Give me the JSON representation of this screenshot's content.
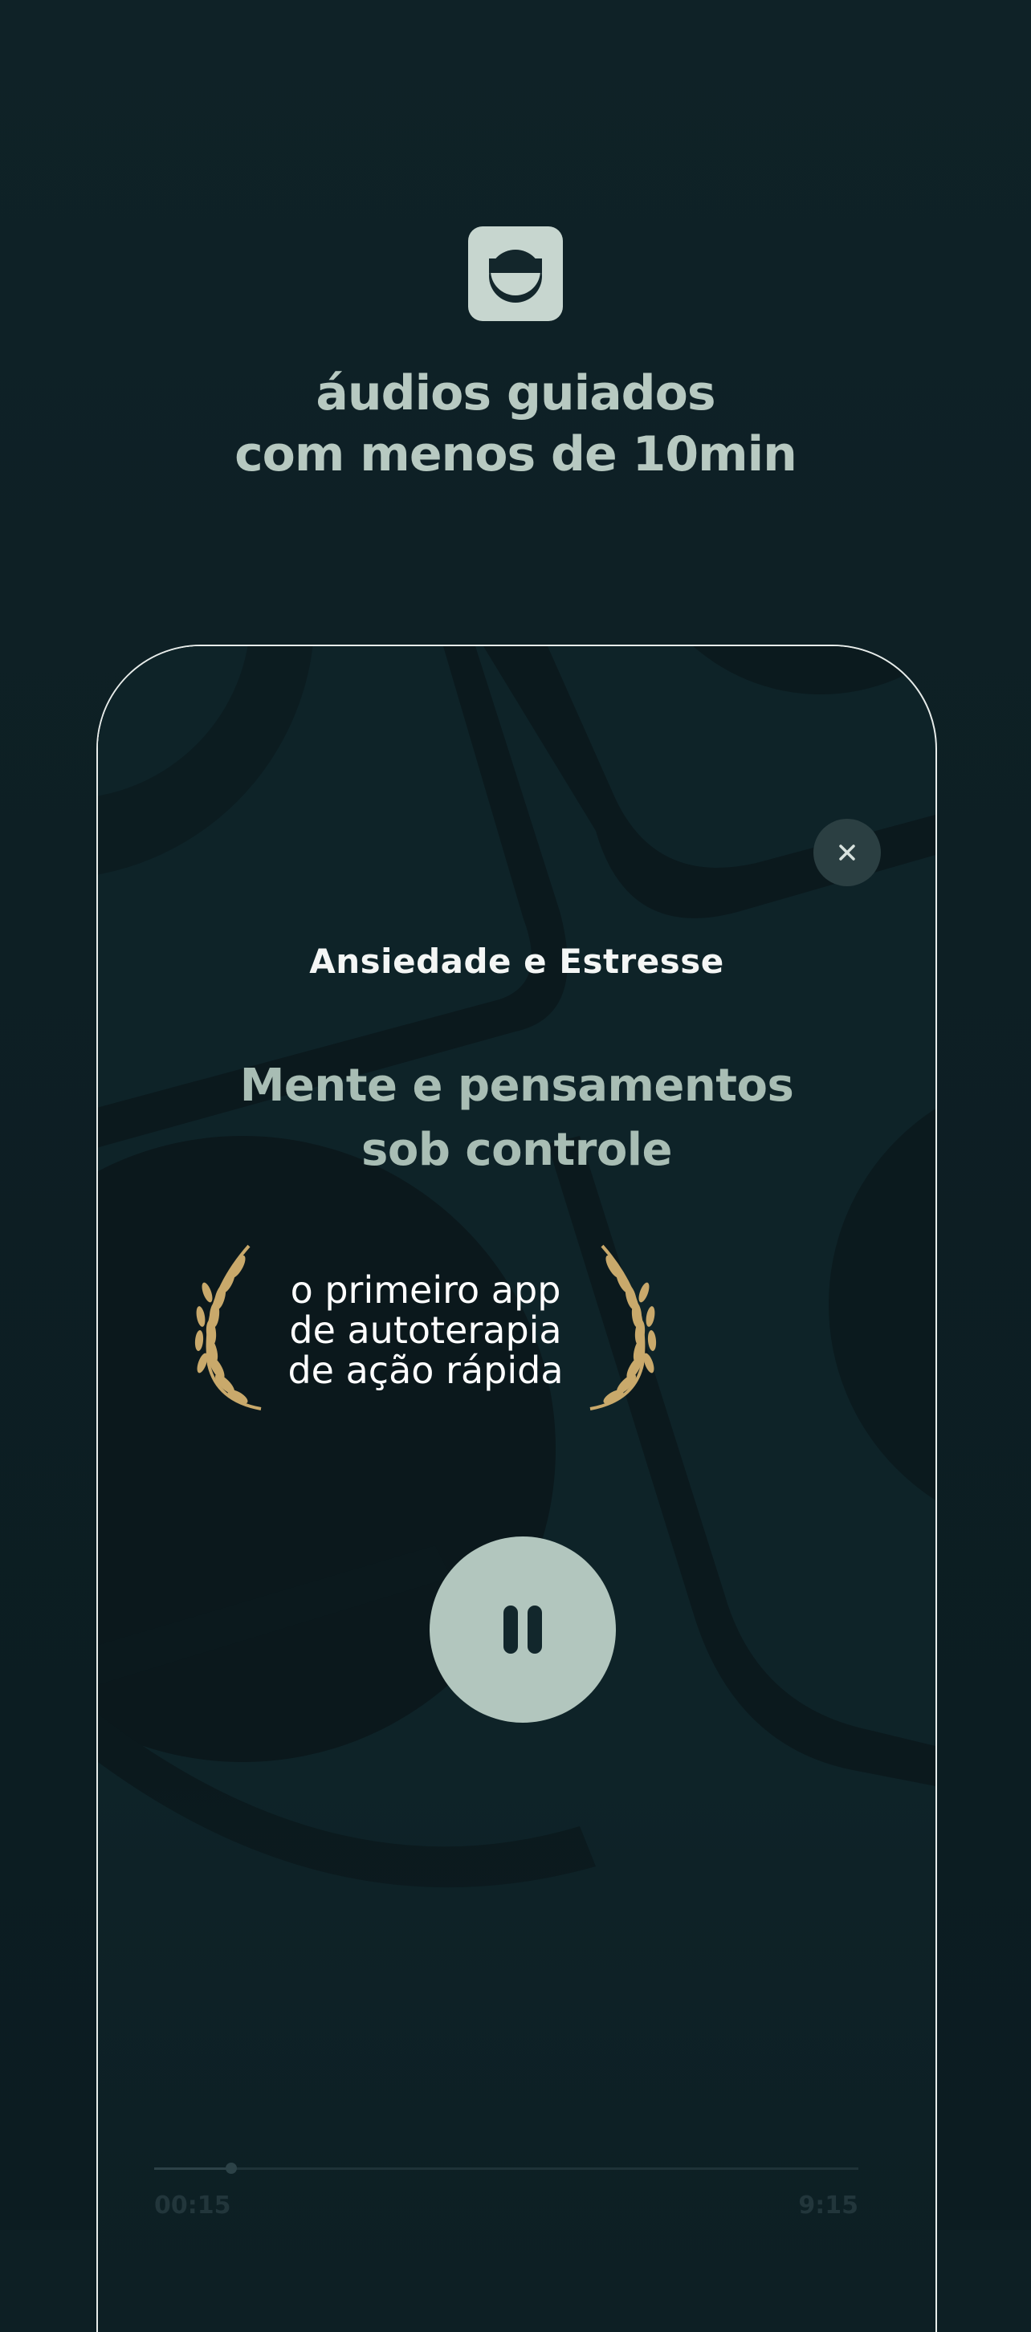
{
  "header": {
    "logo_icon": "smile-face-logo-icon",
    "headline_line1": "áudios guiados",
    "headline_line2": "com menos de 10min"
  },
  "player": {
    "close_icon": "close-icon",
    "close_glyph": "×",
    "category": "Ansiedade e Estresse",
    "title_line1": "Mente e pensamentos",
    "title_line2": "sob controle",
    "pause_icon": "pause-icon",
    "progress_fraction": 0.11,
    "time_elapsed": "00:15",
    "time_total": "9:15"
  },
  "award": {
    "laurel_icon": "laurel-wreath-icon",
    "line1": "o primeiro app",
    "line2": "de autoterapia",
    "line3": "de ação rápida"
  },
  "colors": {
    "background": "#0d1f24",
    "accent": "#b2c6be",
    "laurel_gold": "#c9a96b"
  }
}
